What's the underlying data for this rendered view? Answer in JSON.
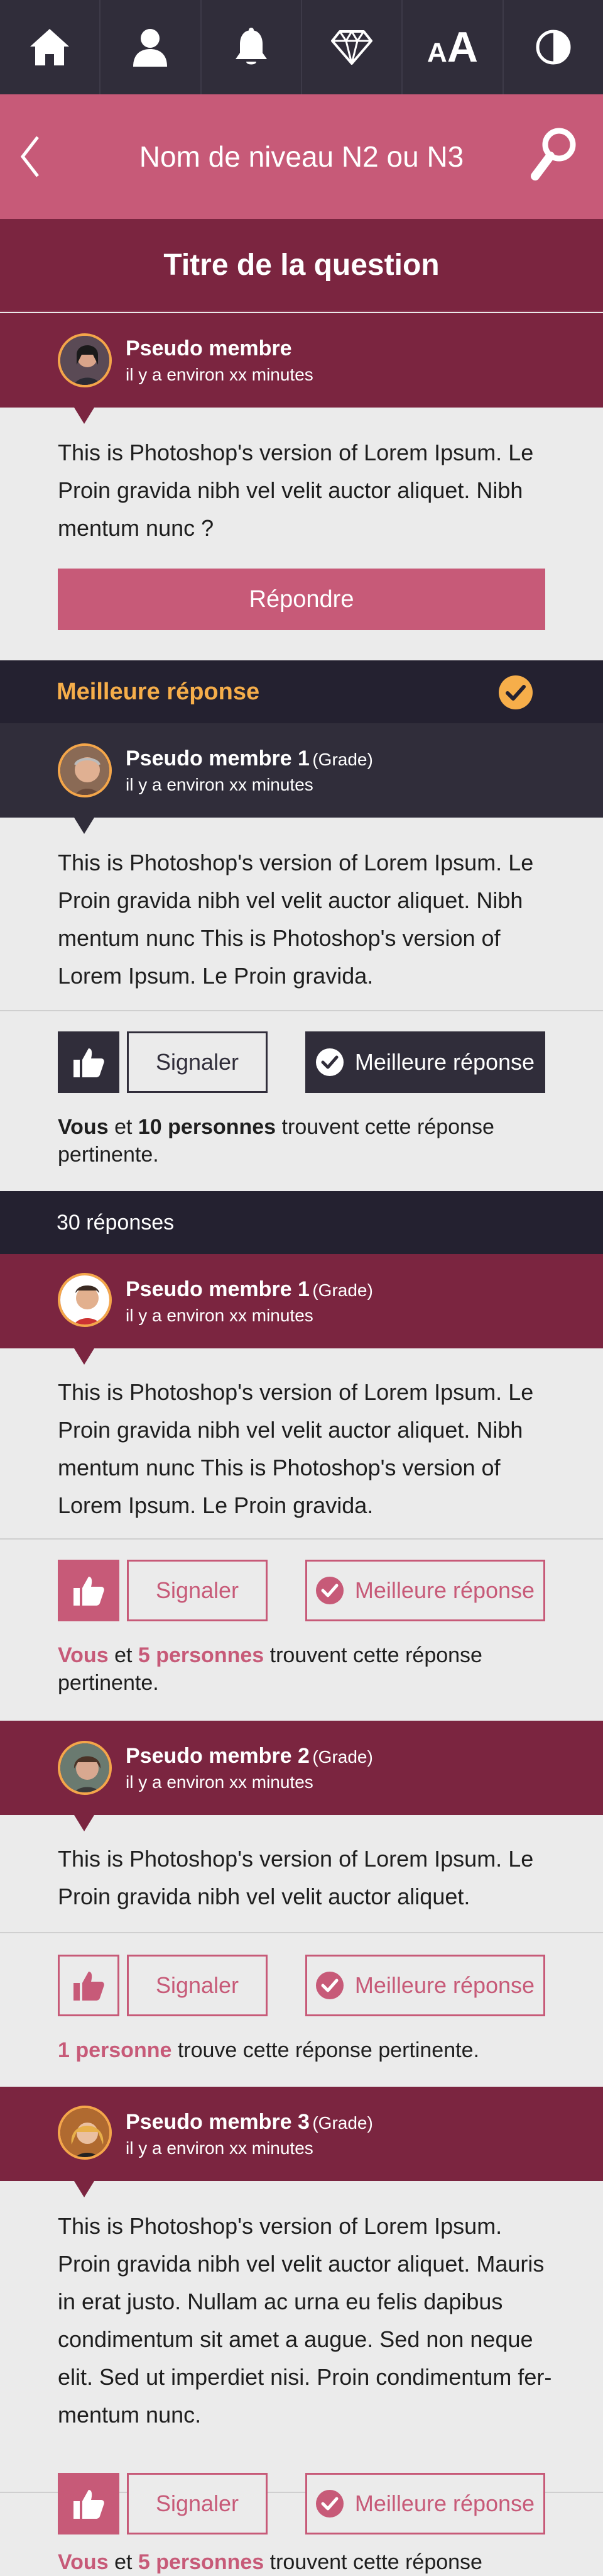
{
  "topbar": {
    "icons": [
      "home-icon",
      "user-icon",
      "bell-icon",
      "diamond-icon",
      "font-size-icon",
      "contrast-icon"
    ],
    "font_small": "A",
    "font_big": "A"
  },
  "nav": {
    "title": "Nom de niveau N2 ou N3"
  },
  "question": {
    "title": "Titre de la question",
    "author": "Pseudo membre",
    "time": "il y a environ xx minutes",
    "text": "This is Photoshop's version  of Lorem Ipsum. Le Proin gravida nibh vel velit auctor aliquet. Nibh mentum nunc ?",
    "reply_label": "Répondre"
  },
  "best_answer": {
    "heading": "Meilleure réponse",
    "author": "Pseudo membre 1",
    "grade": "(Grade)",
    "time": "il y a environ xx minutes",
    "text": "This is Photoshop's version  of Lorem Ipsum. Le Proin gravida nibh vel velit auctor aliquet. Nibh mentum nunc This is Photoshop's version  of Lorem Ipsum. Le Proin gravida.",
    "signal_label": "Signaler",
    "best_label": "Meilleure réponse",
    "likes_vous": "Vous",
    "likes_et": "et",
    "likes_count": "10 personnes",
    "likes_rest": "trouvent cette réponse pertinente."
  },
  "responses_count": "30 réponses",
  "answers": [
    {
      "author": "Pseudo membre 1",
      "grade": "(Grade)",
      "time": "il y a environ xx minutes",
      "text": "This is Photoshop's version  of Lorem Ipsum. Le Proin gravida nibh vel velit auctor aliquet. Nibh mentum nunc This is Photoshop's version  of Lorem Ipsum. Le Proin gravida.",
      "signal_label": "Signaler",
      "best_label": "Meilleure réponse",
      "likes_vous": "Vous",
      "likes_et": "et",
      "likes_count": "5 personnes",
      "likes_rest": "trouvent cette réponse pertinente."
    },
    {
      "author": "Pseudo membre 2",
      "grade": "(Grade)",
      "time": "il y a environ xx minutes",
      "text": "This is Photoshop's version  of Lorem Ipsum. Le Proin gravida nibh vel velit auctor aliquet.",
      "signal_label": "Signaler",
      "best_label": "Meilleure réponse",
      "likes_count": "1 personne",
      "likes_rest": "trouve cette réponse pertinente."
    },
    {
      "author": "Pseudo membre 3",
      "grade": "(Grade)",
      "time": "il y a environ xx minutes",
      "text": "This is Photoshop's version  of Lorem Ipsum. Proin gravida nibh vel velit auctor aliquet. Mauris in erat justo. Nullam ac urna eu felis dapibus condimentum sit amet a augue. Sed non neque elit. Sed ut imperdiet nisi. Proin condimentum fer-mentum nunc.",
      "signal_label": "Signaler",
      "best_label": "Meilleure réponse",
      "likes_vous": "Vous",
      "likes_et": "et",
      "likes_count": "5 personnes",
      "likes_rest": "trouvent cette réponse"
    }
  ],
  "colors": {
    "topbar": "#302d3a",
    "nav": "#c75a78",
    "crimson": "#7b2540",
    "dark": "#302d3a",
    "orange": "#f6ae4a",
    "background": "#ebebeb"
  }
}
